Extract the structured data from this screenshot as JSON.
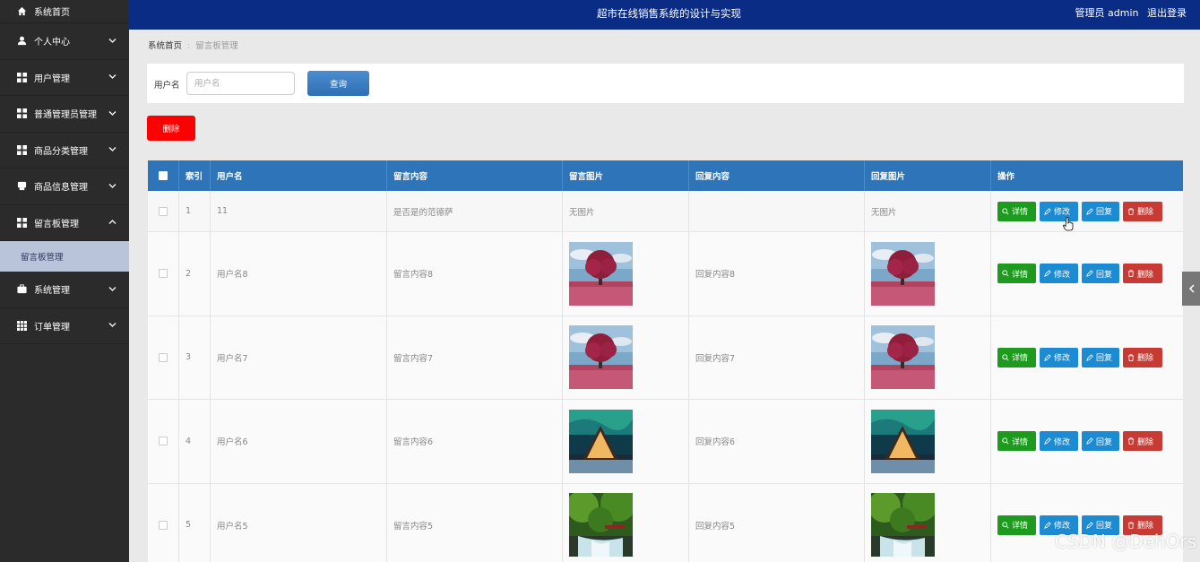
{
  "sidebar": {
    "items": [
      {
        "label": "系统首页",
        "icon": "home-icon"
      },
      {
        "label": "个人中心",
        "icon": "user-icon"
      },
      {
        "label": "用户管理",
        "icon": "grid-icon"
      },
      {
        "label": "普通管理员管理",
        "icon": "grid-icon"
      },
      {
        "label": "商品分类管理",
        "icon": "grid-icon"
      },
      {
        "label": "商品信息管理",
        "icon": "printer-icon"
      },
      {
        "label": "留言板管理",
        "icon": "grid-icon"
      },
      {
        "label": "系统管理",
        "icon": "briefcase-icon"
      },
      {
        "label": "订单管理",
        "icon": "table-icon"
      }
    ],
    "active_sub": "留言板管理"
  },
  "header": {
    "title": "超市在线销售系统的设计与实现",
    "user": "管理员 admin",
    "logout": "退出登录"
  },
  "breadcrumb": {
    "home": "系统首页",
    "current": "留言板管理"
  },
  "search": {
    "label": "用户名",
    "placeholder": "用户名",
    "button": "查询"
  },
  "actions": {
    "delete": "删除"
  },
  "table": {
    "headers": [
      "索引",
      "用户名",
      "留言内容",
      "留言图片",
      "回复内容",
      "回复图片",
      "操作"
    ],
    "ops": {
      "detail": "详情",
      "edit": "修改",
      "reply": "回复",
      "delete": "删除"
    },
    "rows": [
      {
        "index": "1",
        "username": "11",
        "message": "是否是的范德萨",
        "msg_image": "无图片",
        "reply": "",
        "reply_image": "无图片"
      },
      {
        "index": "2",
        "username": "用户名8",
        "message": "留言内容8",
        "msg_image": "red-tree",
        "reply": "回复内容8",
        "reply_image": "red-tree"
      },
      {
        "index": "3",
        "username": "用户名7",
        "message": "留言内容7",
        "msg_image": "red-tree",
        "reply": "回复内容7",
        "reply_image": "red-tree"
      },
      {
        "index": "4",
        "username": "用户名6",
        "message": "留言内容6",
        "msg_image": "aurora-cabin",
        "reply": "回复内容6",
        "reply_image": "aurora-cabin"
      },
      {
        "index": "5",
        "username": "用户名5",
        "message": "留言内容5",
        "msg_image": "forest-waterfall",
        "reply": "回复内容5",
        "reply_image": "forest-waterfall"
      }
    ]
  },
  "watermark": "CSDN @DehOrs",
  "colors": {
    "topbar": "#0a2c84",
    "sidebar": "#2b2b2b",
    "table_header": "#2e74b8",
    "detail": "#1e9b1e",
    "edit": "#1c8bd2",
    "delete": "#c83b35",
    "delete_top": "#ff0000"
  }
}
